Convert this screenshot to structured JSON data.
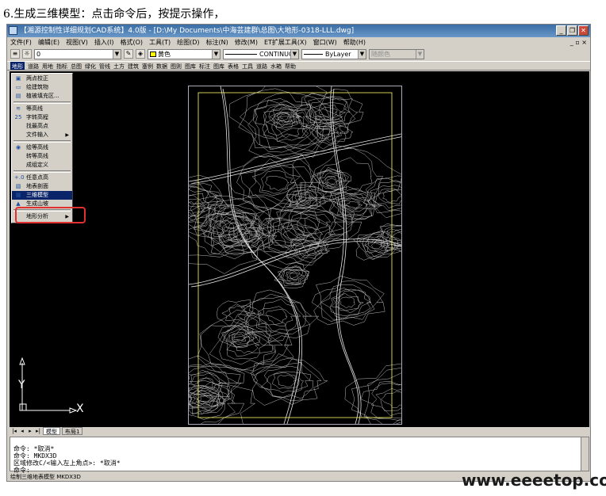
{
  "heading": "6.生成三维模型：点击命令后，按提示操作，",
  "window": {
    "title": "【湘源控制性详细规划CAD系统】4.0版 - [D:\\My Documents\\中海芸建群\\总图\\大地形-0318-LLL.dwg]",
    "buttons": [
      "_",
      "❐",
      "✕"
    ]
  },
  "menubar": [
    "文件(F)",
    "编辑(E)",
    "视图(V)",
    "插入(I)",
    "格式(O)",
    "工具(T)",
    "绘图(D)",
    "标注(N)",
    "修改(M)",
    "ET扩展工具(X)",
    "窗口(W)",
    "帮助(H)"
  ],
  "mdi_buttons": "_ ▫ ×",
  "toolbar": {
    "layer_combo": "0",
    "color_combo": "黄色",
    "linetype_combo": "CONTINUOUS",
    "lineweight_combo": "ByLayer",
    "plotstyle_combo": "随颜色"
  },
  "command_menu": [
    "地形",
    "道路",
    "用地",
    "指标",
    "总图",
    "绿化",
    "管线",
    "土方",
    "建筑",
    "塞例",
    "数据",
    "图则",
    "图库",
    "标注",
    "图库",
    "表格",
    "工具",
    "道路",
    "水箱",
    "帮助"
  ],
  "command_menu_active": 0,
  "dropdown": [
    {
      "icon": "▣",
      "label": "两点校正",
      "type": "item"
    },
    {
      "icon": "▭",
      "label": "绘建筑物",
      "type": "item"
    },
    {
      "icon": "▤",
      "label": "植被填充区...",
      "type": "item"
    },
    {
      "type": "sep"
    },
    {
      "icon": "≋",
      "label": "等高线",
      "type": "item"
    },
    {
      "icon": "25",
      "label": "字转高程",
      "type": "item"
    },
    {
      "icon": "",
      "label": "找最高点",
      "type": "item"
    },
    {
      "icon": "",
      "label": "文件输入",
      "type": "item",
      "sub": true
    },
    {
      "type": "sep"
    },
    {
      "icon": "◉",
      "label": "绘等高线",
      "type": "item"
    },
    {
      "icon": "",
      "label": "转等高线",
      "type": "item"
    },
    {
      "icon": "",
      "label": "成组定义",
      "type": "item"
    },
    {
      "type": "sep"
    },
    {
      "icon": "+.0",
      "label": "任意点高",
      "type": "item"
    },
    {
      "icon": "▧",
      "label": "地表剖面",
      "type": "item"
    },
    {
      "icon": "▩",
      "label": "三维模型",
      "type": "item",
      "selected": true
    },
    {
      "icon": "▲",
      "label": "生成山坡",
      "type": "item"
    },
    {
      "type": "sep"
    },
    {
      "icon": "",
      "label": "地形分析",
      "type": "item",
      "sub": true
    }
  ],
  "ucs": {
    "y": "Y",
    "x": "X"
  },
  "tabs": [
    "模型",
    "布局1"
  ],
  "command_lines": [
    "命令: *取消*",
    "命令: MKDX3D",
    "区域修改C/<输入左上角点>: *取消*",
    "命令:"
  ],
  "status": "绘制三维地表模型  MKDX3D",
  "watermark": "www.eeeetop.com",
  "colors": {
    "canvas": "#000000",
    "frame": "#ffff66",
    "selection": "#0a246a",
    "highlight_box": "#e03030"
  }
}
